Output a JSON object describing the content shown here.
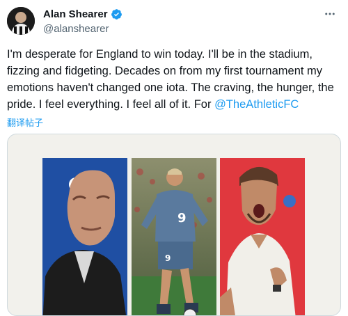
{
  "user": {
    "display_name": "Alan Shearer",
    "handle": "@alanshearer",
    "verified_icon": "verified-badge-icon",
    "verified_color": "#1d9bf0"
  },
  "tweet": {
    "text": "I'm desperate for England to win today. I'll be in the stadium, fizzing and fidgeting. Decades on from my first tournament my emotions haven't changed one iota. The craving, the hunger, the pride. I feel everything. I feel all of it. For ",
    "mention": "@TheAthleticFC",
    "translate_label": "翻译帖子"
  },
  "media": {
    "panels": [
      {
        "name": "portrait-alan-shearer",
        "bg": "#1f4fa3"
      },
      {
        "name": "action-shot-england-number-9",
        "bg": "#6a7a5a",
        "shirt_number": "9"
      },
      {
        "name": "portrait-gareth-southgate",
        "bg": "#e0383e"
      }
    ]
  },
  "colors": {
    "link": "#1d9bf0",
    "text": "#0f1419",
    "secondary": "#536471"
  }
}
